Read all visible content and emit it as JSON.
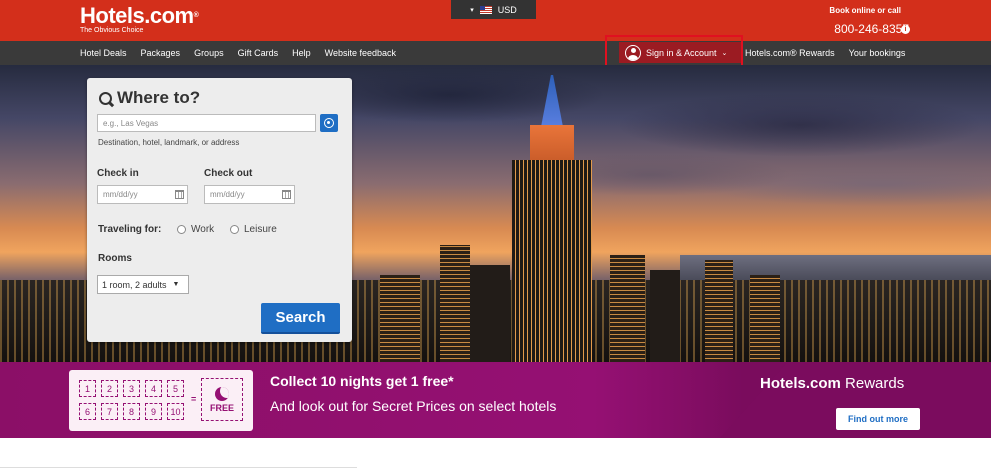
{
  "header": {
    "logo": "Hotels.com",
    "logo_mark": "®",
    "tagline": "The Obvious Choice",
    "currency_label": "USD",
    "book_text": "Book online or call",
    "phone": "800-246-8357"
  },
  "nav": {
    "left": [
      "Hotel Deals",
      "Packages",
      "Groups",
      "Gift Cards",
      "Help",
      "Website feedback"
    ],
    "account": "Sign in & Account",
    "right": [
      "Hotels.com® Rewards",
      "Your bookings"
    ]
  },
  "search": {
    "title": "Where to?",
    "destination_placeholder": "e.g., Las Vegas",
    "destination_hint": "Destination, hotel, landmark, or address",
    "checkin_label": "Check in",
    "checkout_label": "Check out",
    "date_placeholder": "mm/dd/yy",
    "traveling_label": "Traveling for:",
    "option_work": "Work",
    "option_leisure": "Leisure",
    "rooms_label": "Rooms",
    "rooms_value": "1 room, 2 adults",
    "search_button": "Search"
  },
  "rewards": {
    "stamps": [
      "1",
      "2",
      "3",
      "4",
      "5",
      "6",
      "7",
      "8",
      "9",
      "10"
    ],
    "equals": "=",
    "free": "FREE",
    "headline": "Collect 10 nights get 1 free*",
    "subline": "And look out for Secret Prices on select hotels",
    "logo_main": "Hotels.com",
    "logo_rewards": "Rewards",
    "find_out_more": "Find out more"
  },
  "colors": {
    "brand_red": "#d32f1b",
    "nav_dark": "#3a3a3a",
    "accent_blue": "#1f6ec4",
    "rewards_purple": "#951073"
  }
}
